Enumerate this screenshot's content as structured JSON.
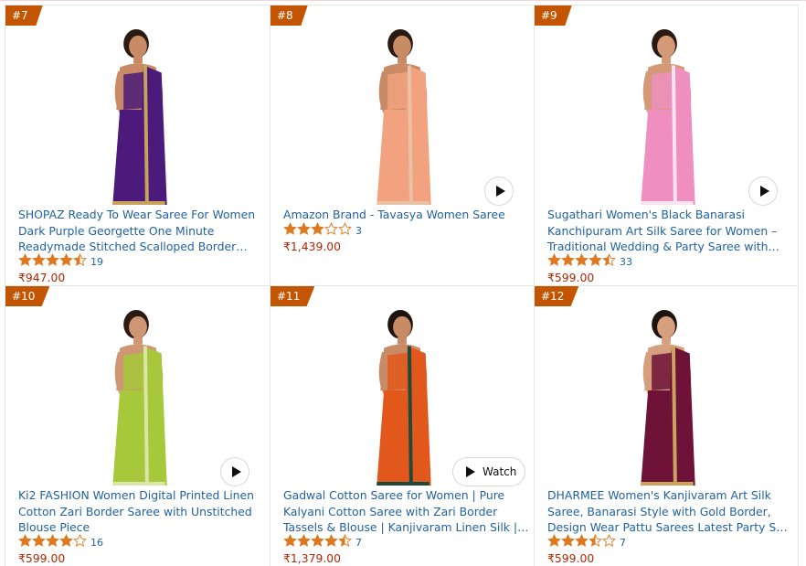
{
  "products": [
    {
      "rank": "#7",
      "title": "SHOPAZ Ready To Wear Saree For Women Dark Purple Georgette One Minute Readymade Stitched Scalloped Border Lace With…",
      "rating": 4.5,
      "reviews": "19",
      "price": "₹947.00",
      "video": "none",
      "colors": {
        "saree": "#4b1a7a",
        "skin": "#c98b66",
        "hair": "#2b1a12",
        "border": "#c8a25a"
      }
    },
    {
      "rank": "#8",
      "title": "Amazon Brand - Tavasya Women Saree",
      "rating": 3.0,
      "reviews": "3",
      "price": "₹1,439.00",
      "video": "play",
      "colors": {
        "saree": "#f2a27f",
        "skin": "#c98b66",
        "hair": "#2b1a12",
        "border": "#e9c2a6"
      }
    },
    {
      "rank": "#9",
      "title": "Sugathari Women's Black Banarasi Kanchipuram Art Silk Saree for Women – Traditional Wedding & Party Saree with Blou…",
      "rating": 4.5,
      "reviews": "33",
      "price": "₹599.00",
      "video": "play",
      "colors": {
        "saree": "#ef8fc0",
        "skin": "#d49a78",
        "hair": "#2b1a12",
        "border": "#fbe3ef"
      }
    },
    {
      "rank": "#10",
      "title": "Ki2 FASHION Women Digital Printed Linen Cotton Zari Border Saree with Unstitched Blouse Piece",
      "rating": 4.0,
      "reviews": "16",
      "price": "₹599.00",
      "video": "play",
      "colors": {
        "saree": "#a6c83a",
        "skin": "#cf9673",
        "hair": "#2b1a12",
        "border": "#d9e6a8"
      }
    },
    {
      "rank": "#11",
      "title": "Gadwal Cotton Saree for Women | Pure Kalyani Cotton Saree with Zari Border Tassels & Blouse | Kanjivaram Linen Silk | Handloom Weave",
      "rating": 4.5,
      "reviews": "7",
      "price": "₹1,379.00",
      "video": "watch",
      "colors": {
        "saree": "#e2581c",
        "skin": "#c98b66",
        "hair": "#1e140f",
        "border": "#1f4a3a"
      }
    },
    {
      "rank": "#12",
      "title": "DHARMEE Women's Kanjivaram Art Silk Saree, Banarasi Style with Gold Border, Design Wear Pattu Sarees Latest Party Sari collections…",
      "rating": 3.5,
      "reviews": "7",
      "price": "₹599.00",
      "video": "none",
      "colors": {
        "saree": "#6e1238",
        "skin": "#d6a07f",
        "hair": "#1e140f",
        "border": "#c9a45a"
      }
    }
  ],
  "watch_label": "Watch",
  "star_color": "#de7921",
  "star_empty_color": "#de7921"
}
